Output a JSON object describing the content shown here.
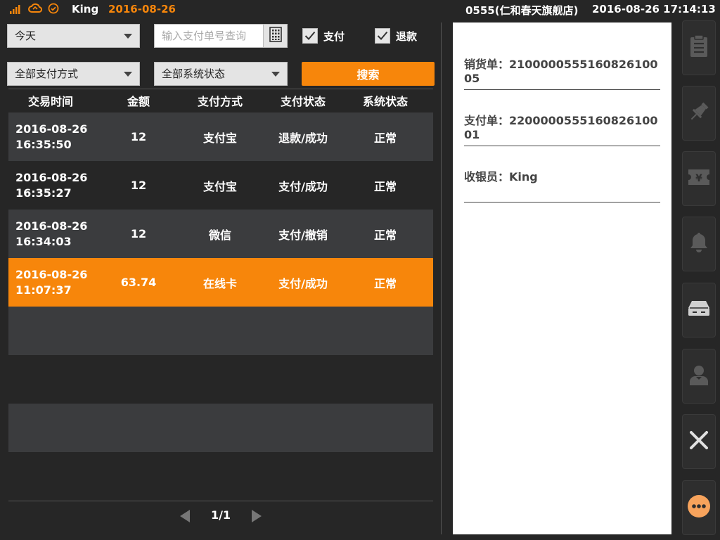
{
  "statusbar": {
    "icons": [
      "signal-icon",
      "cloud-sync-icon",
      "check-circle-icon"
    ],
    "user": "King",
    "date": "2016-08-26",
    "store": "0555(仁和春天旗舰店)",
    "datetime": "2016-08-26 17:14:13"
  },
  "filters": {
    "date_range": "今天",
    "search_placeholder": "输入支付单号查询",
    "search_value": "",
    "pay_checkbox": {
      "label": "支付",
      "checked": true
    },
    "refund_checkbox": {
      "label": "退款",
      "checked": true
    },
    "pay_method": "全部支付方式",
    "system_status": "全部系统状态",
    "search_button": "搜索"
  },
  "table": {
    "headers": [
      "交易时间",
      "金额",
      "支付方式",
      "支付状态",
      "系统状态"
    ],
    "rows": [
      {
        "date": "2016-08-26",
        "time": "16:35:50",
        "amount": "12",
        "method": "支付宝",
        "pay_status": "退款/成功",
        "sys_status": "正常"
      },
      {
        "date": "2016-08-26",
        "time": "16:35:27",
        "amount": "12",
        "method": "支付宝",
        "pay_status": "支付/成功",
        "sys_status": "正常"
      },
      {
        "date": "2016-08-26",
        "time": "16:34:03",
        "amount": "12",
        "method": "微信",
        "pay_status": "支付/撤销",
        "sys_status": "正常"
      },
      {
        "date": "2016-08-26",
        "time": "11:07:37",
        "amount": "63.74",
        "method": "在线卡",
        "pay_status": "支付/成功",
        "sys_status": "正常"
      }
    ],
    "selected_row": 3
  },
  "pagination": {
    "label": "1/1"
  },
  "detail": {
    "sales_order": "销货单：2100000555160826100​05",
    "payment_order": "支付单：2200000555160826100​01",
    "cashier": "收银员：King"
  },
  "rail": {
    "buttons": [
      "clipboard-icon",
      "pin-icon",
      "yuan-ticket-icon",
      "bell-icon",
      "cash-drawer-icon",
      "cashier-user-icon",
      "close-icon",
      "more-icon"
    ]
  },
  "colors": {
    "accent": "#f7860b",
    "background": "#262626",
    "row_dark": "#3b3c3e"
  }
}
